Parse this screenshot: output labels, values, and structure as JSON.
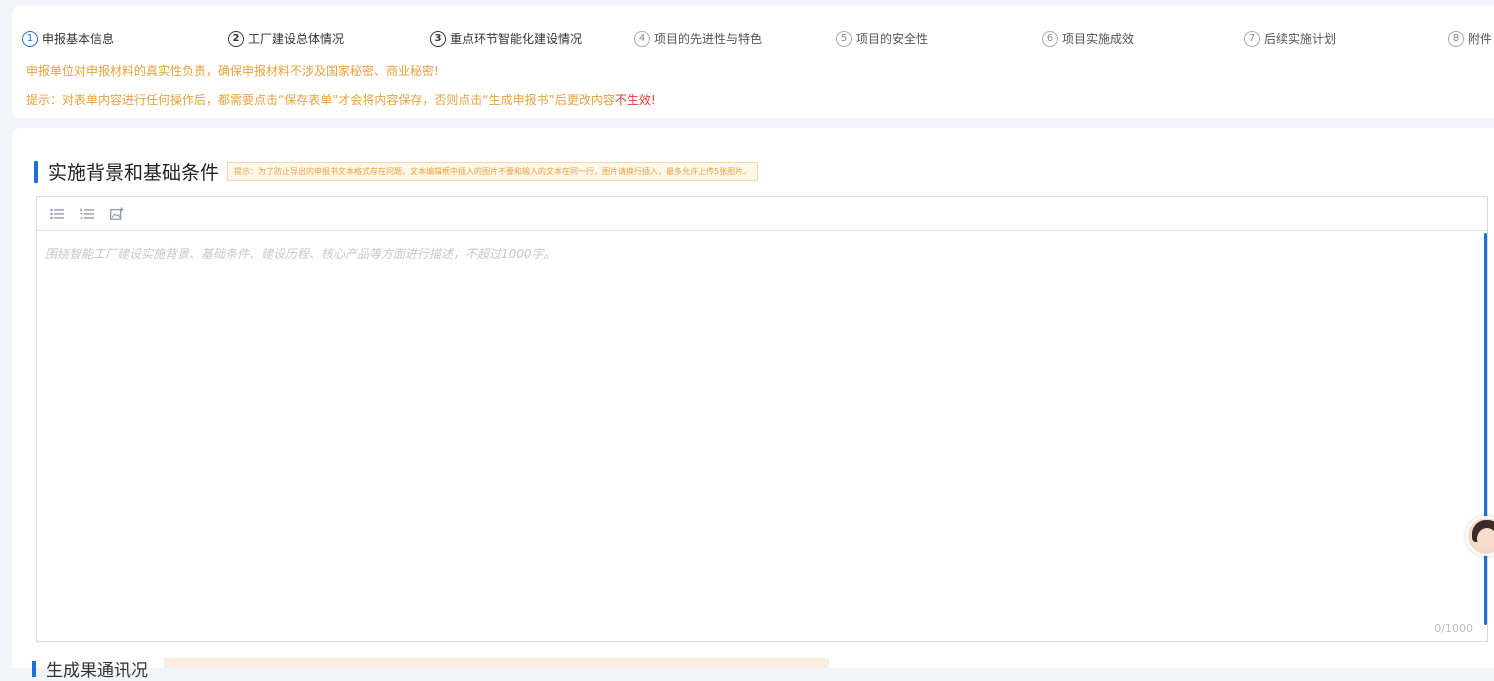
{
  "steps": [
    {
      "num": "1",
      "label": "申报基本信息"
    },
    {
      "num": "2",
      "label": "工厂建设总体情况"
    },
    {
      "num": "3",
      "label": "重点环节智能化建设情况"
    },
    {
      "num": "4",
      "label": "项目的先进性与特色"
    },
    {
      "num": "5",
      "label": "项目的安全性"
    },
    {
      "num": "6",
      "label": "项目实施成效"
    },
    {
      "num": "7",
      "label": "后续实施计划"
    },
    {
      "num": "8",
      "label": "附件"
    }
  ],
  "notices": {
    "line1": "申报单位对申报材料的真实性负责，确保申报材料不涉及国家秘密、商业秘密!",
    "line2_prefix": "提示：对表单内容进行任何操作后，都需要点击“保存表单”才会将内容保存，否则点击“生成申报书”后更改内容",
    "line2_red": "不生效!"
  },
  "section": {
    "title": "实施背景和基础条件",
    "tip": "提示：为了防止导出的申报书文本格式存在问题，文本编辑框中插入的图片不要和输入的文本在同一行，图片请换行插入，最多允许上传5张图片。"
  },
  "editor": {
    "placeholder": "围绕智能工厂建设实施背景、基础条件、建设历程、核心产品等方面进行描述，不超过1000字。",
    "counter": "0/1000",
    "tools": [
      "unordered-list-icon",
      "ordered-list-icon",
      "image-insert-icon"
    ]
  },
  "next_section": {
    "title": "生成果通讯况"
  }
}
